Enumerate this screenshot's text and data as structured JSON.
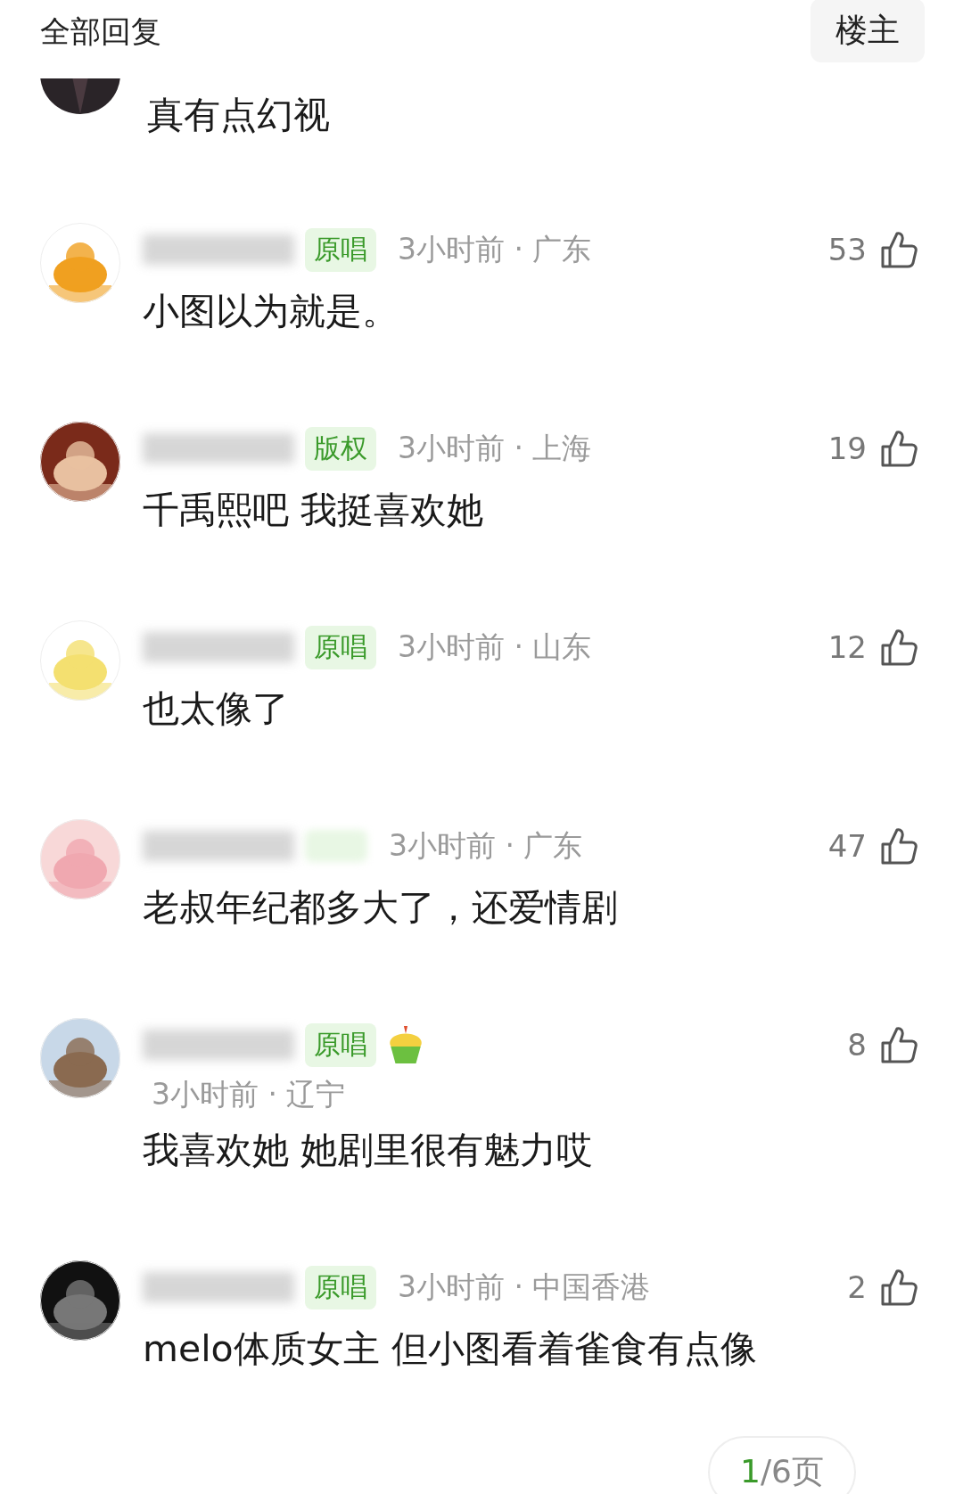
{
  "header": {
    "title": "全部回复",
    "op_button": "楼主"
  },
  "cut_comment": {
    "text": "真有点幻视"
  },
  "comments": [
    {
      "kind": "inline",
      "badge": "原唱",
      "cupcake": false,
      "meta": "3小时前 · 广东",
      "likes": "53",
      "text": "小图以为就是。"
    },
    {
      "kind": "inline",
      "badge": "版权",
      "cupcake": false,
      "meta": "3小时前 · 上海",
      "likes": "19",
      "text": "千禹熙吧 我挺喜欢她"
    },
    {
      "kind": "inline",
      "badge": "原唱",
      "cupcake": false,
      "meta": "3小时前 · 山东",
      "likes": "12",
      "text": "也太像了"
    },
    {
      "kind": "inline",
      "cupcake": false,
      "meta": "3小时前 · 广东",
      "likes": "47",
      "text": "老叔年纪都多大了，还爱情剧"
    },
    {
      "kind": "wrapped",
      "badge": "原唱",
      "cupcake": true,
      "meta": "3小时前 · 辽宁",
      "likes": "8",
      "text": "我喜欢她 她剧里很有魅力哎"
    },
    {
      "kind": "inline",
      "badge": "原唱",
      "cupcake": false,
      "meta": "3小时前 · 中国香港",
      "likes": "2",
      "text": "melo体质女主 但小图看着雀食有点像"
    }
  ],
  "pager": {
    "current": "1",
    "rest": "/6页"
  }
}
